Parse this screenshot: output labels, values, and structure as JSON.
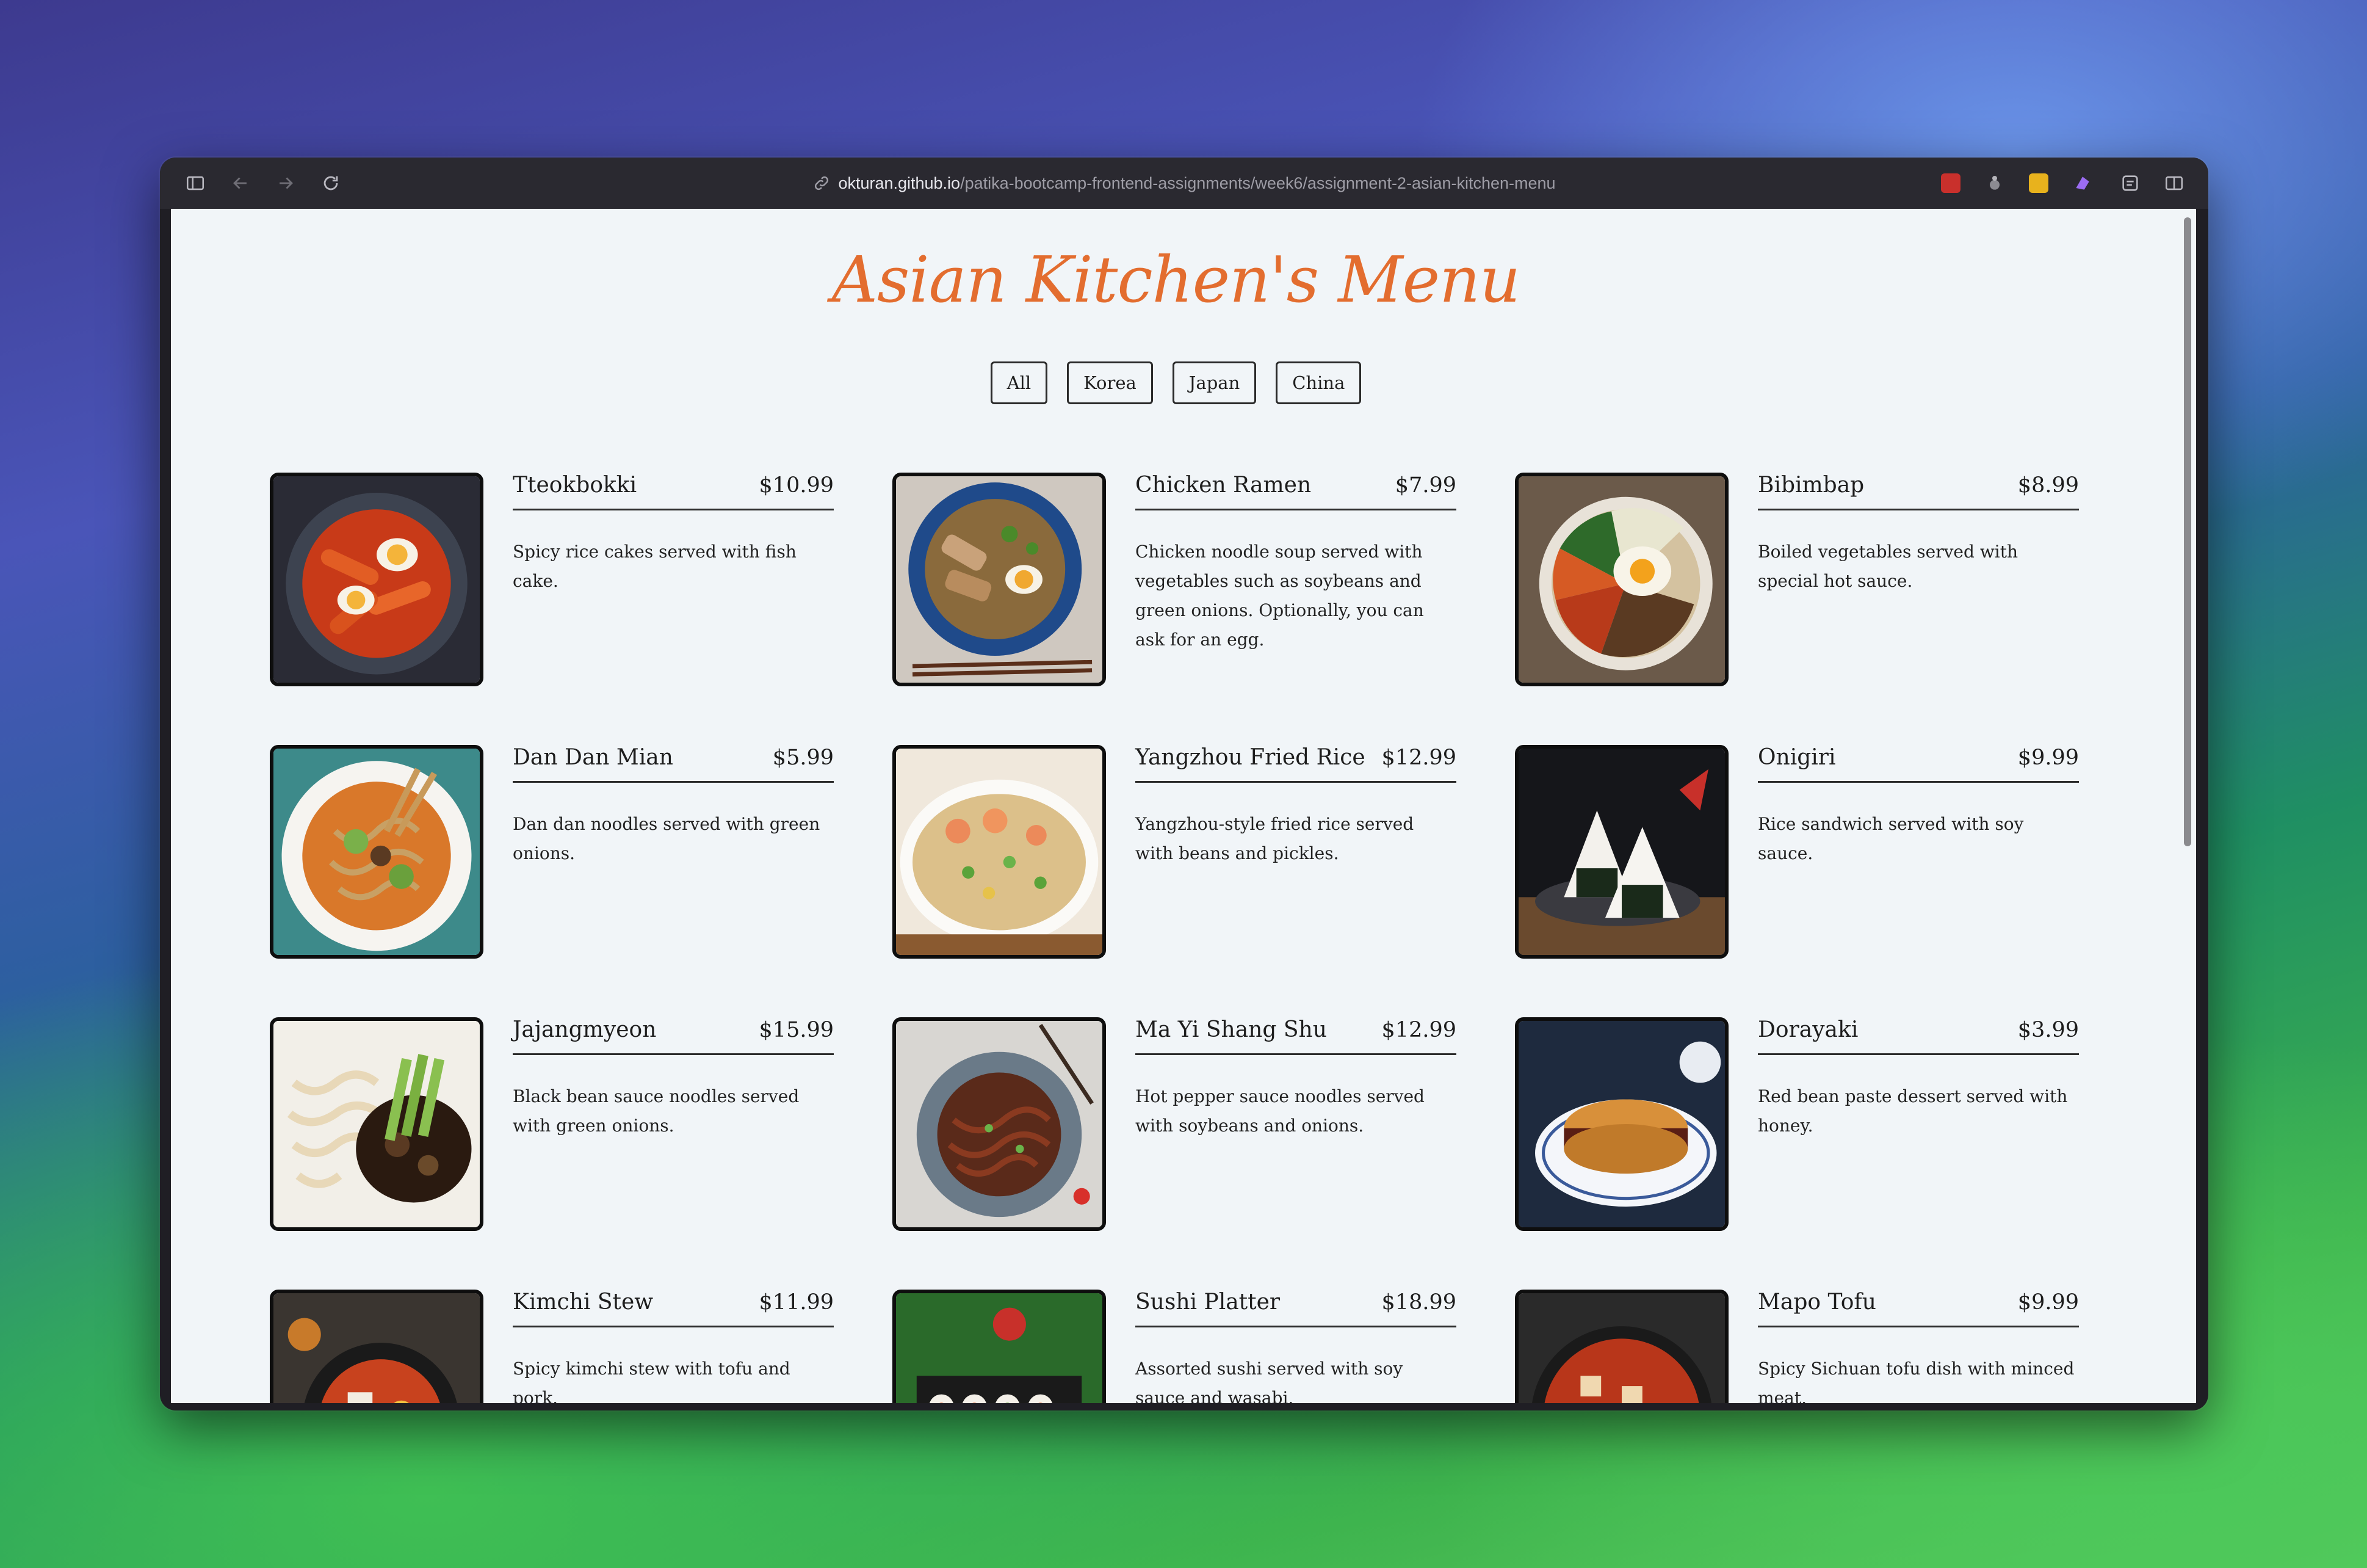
{
  "browser": {
    "url_host": "okturan.github.io",
    "url_path": "/patika-bootcamp-frontend-assignments/week6/assignment-2-asian-kitchen-menu"
  },
  "page": {
    "title": "Asian Kitchen's Menu",
    "filters": [
      "All",
      "Korea",
      "Japan",
      "China"
    ]
  },
  "menu": [
    {
      "name": "Tteokbokki",
      "price": "$10.99",
      "desc": "Spicy rice cakes served with fish cake.",
      "icon": "tteokbokki-photo"
    },
    {
      "name": "Chicken Ramen",
      "price": "$7.99",
      "desc": "Chicken noodle soup served with vegetables such as soybeans and green onions. Optionally, you can ask for an egg.",
      "icon": "ramen-photo"
    },
    {
      "name": "Bibimbap",
      "price": "$8.99",
      "desc": "Boiled vegetables served with special hot sauce.",
      "icon": "bibimbap-photo"
    },
    {
      "name": "Dan Dan Mian",
      "price": "$5.99",
      "desc": "Dan dan noodles served with green onions.",
      "icon": "dandan-photo"
    },
    {
      "name": "Yangzhou Fried Rice",
      "price": "$12.99",
      "desc": "Yangzhou-style fried rice served with beans and pickles.",
      "icon": "friedrice-photo"
    },
    {
      "name": "Onigiri",
      "price": "$9.99",
      "desc": "Rice sandwich served with soy sauce.",
      "icon": "onigiri-photo"
    },
    {
      "name": "Jajangmyeon",
      "price": "$15.99",
      "desc": "Black bean sauce noodles served with green onions.",
      "icon": "jajangmyeon-photo"
    },
    {
      "name": "Ma Yi Shang Shu",
      "price": "$12.99",
      "desc": "Hot pepper sauce noodles served with soybeans and onions.",
      "icon": "mayi-photo"
    },
    {
      "name": "Dorayaki",
      "price": "$3.99",
      "desc": "Red bean paste dessert served with honey.",
      "icon": "dorayaki-photo"
    },
    {
      "name": "Kimchi Stew",
      "price": "$11.99",
      "desc": "Spicy kimchi stew with tofu and pork.",
      "icon": "kimchi-photo"
    },
    {
      "name": "Sushi Platter",
      "price": "$18.99",
      "desc": "Assorted sushi served with soy sauce and wasabi.",
      "icon": "sushi-photo"
    },
    {
      "name": "Mapo Tofu",
      "price": "$9.99",
      "desc": "Spicy Sichuan tofu dish with minced meat.",
      "icon": "mapo-photo"
    }
  ]
}
